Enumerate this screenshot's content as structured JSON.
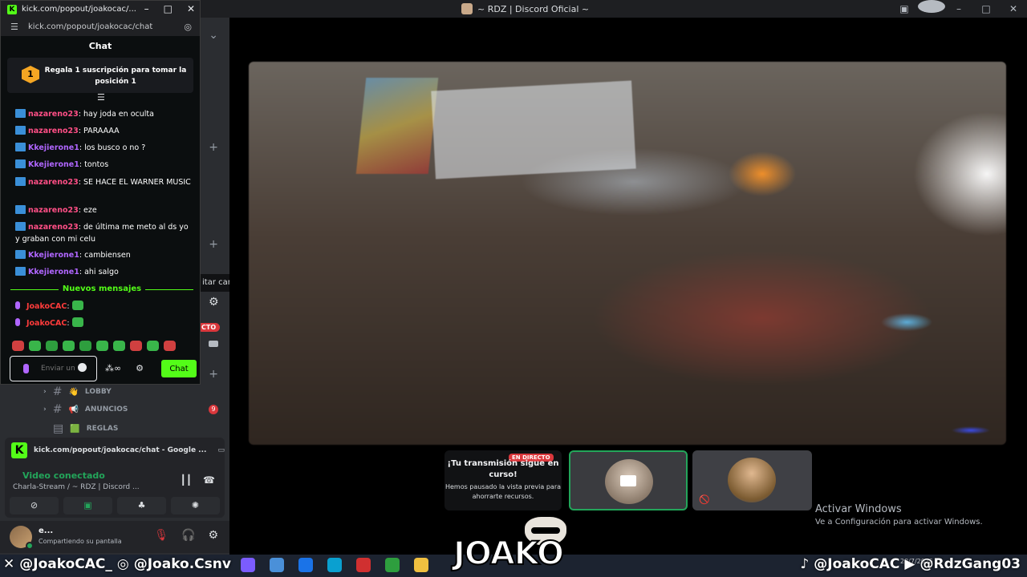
{
  "discord": {
    "window_title": "~ RDZ | Discord Oficial ~",
    "help_label": "?",
    "tooltip": "itar canal",
    "live_badge": "CTO",
    "channels": [
      {
        "label": "LOBBY",
        "emoji": "👋"
      },
      {
        "label": "ANUNCIOS",
        "emoji": "📢"
      },
      {
        "label": "REGLAS",
        "emoji": "🟩"
      }
    ],
    "unread_count": "9",
    "voice": {
      "tab_title": "kick.com/popout/joakocac/chat - Google ...",
      "status": "Video conectado",
      "channel": "Charla-Stream / ~ RDZ | Discord ..."
    },
    "user": {
      "name": "e...",
      "status": "Compartiendo su pantalla"
    },
    "stream_tile": {
      "live": "EN DIRECTO",
      "title": "¡Tu transmisión sigue en curso!",
      "subtitle": "Hemos pausado la vista previa para ahorrarte recursos."
    },
    "activate": {
      "title": "Activar Windows",
      "subtitle": "Ve a Configuración para activar Windows."
    }
  },
  "kick": {
    "title": "kick.com/popout/joakocac/...",
    "url": "kick.com/popout/joakocac/chat",
    "chat_title": "Chat",
    "promo": "Regala 1 suscripción para tomar la posición 1",
    "rank": "1",
    "messages": [
      {
        "user": "nazareno23",
        "text": "hay joda en oculta",
        "color": "pink"
      },
      {
        "user": "nazareno23",
        "text": "PARAAAA",
        "color": "pink"
      },
      {
        "user": "Kkejierone1",
        "text": "los busco o no ?",
        "color": "purple"
      },
      {
        "user": "Kkejierone1",
        "text": "tontos",
        "color": "purple"
      },
      {
        "user": "nazareno23",
        "text": "SE HACE EL WARNER MUSIC",
        "color": "pink"
      },
      {
        "user": "nazareno23",
        "text": "eze",
        "color": "pink"
      },
      {
        "user": "nazareno23",
        "text": "de última me meto al ds yo y graban con mi celu",
        "color": "pink"
      },
      {
        "user": "Kkejierone1",
        "text": "cambiensen",
        "color": "purple"
      },
      {
        "user": "Kkejierone1",
        "text": "ahi salgo",
        "color": "purple"
      }
    ],
    "new_messages": "Nuevos mensajes",
    "own_messages": [
      "JoakoCAC",
      "JoakoCAC"
    ],
    "input_placeholder": "Enviar un mensaje",
    "send_label": "Chat"
  },
  "overlay": {
    "left_handles": [
      "@JoakoCAC_",
      "@Joako.Csnv"
    ],
    "right_handles": [
      "@JoakoCAC",
      "@RdzGang03"
    ],
    "logo_text": "JOAKO",
    "date": "28/7/2025"
  }
}
